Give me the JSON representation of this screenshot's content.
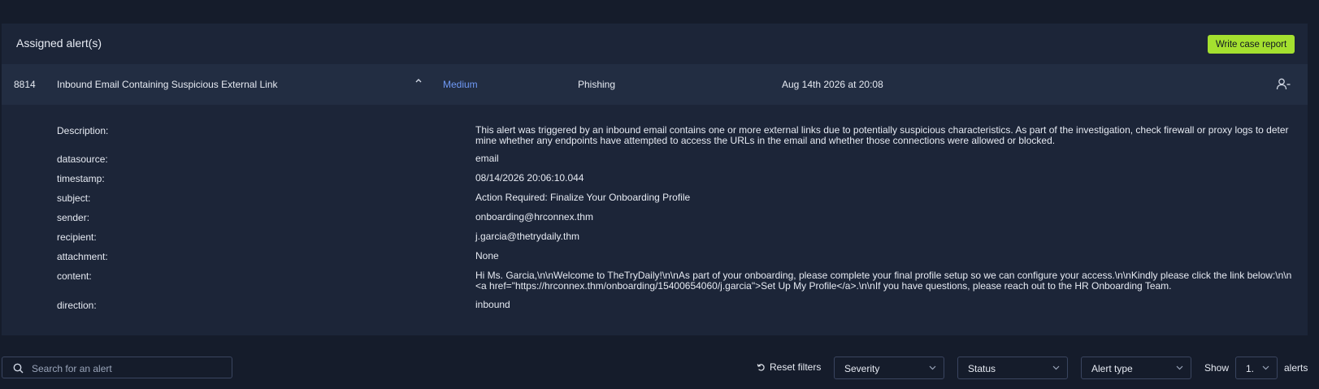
{
  "panel": {
    "title": "Assigned alert(s)",
    "write_button": "Write case report"
  },
  "alert": {
    "id": "8814",
    "title": "Inbound Email Containing Suspicious External Link",
    "severity": "Medium",
    "type": "Phishing",
    "date": "Aug 14th 2026 at 20:08"
  },
  "details": [
    {
      "key": "Description:",
      "value": "This alert was triggered by an inbound email contains one or more external links due to potentially suspicious characteristics. As part of the investigation, check firewall or proxy logs to determine whether any endpoints have attempted to access the URLs in the email and whether those connections were allowed or blocked."
    },
    {
      "key": "datasource:",
      "value": "email"
    },
    {
      "key": "timestamp:",
      "value": "08/14/2026 20:06:10.044"
    },
    {
      "key": "subject:",
      "value": "Action Required: Finalize Your Onboarding Profile"
    },
    {
      "key": "sender:",
      "value": "onboarding@hrconnex.thm"
    },
    {
      "key": "recipient:",
      "value": "j.garcia@thetrydaily.thm"
    },
    {
      "key": "attachment:",
      "value": "None"
    },
    {
      "key": "content:",
      "value": "Hi Ms. Garcia,\\n\\nWelcome to TheTryDaily!\\n\\nAs part of your onboarding, please complete your final profile setup so we can configure your access.\\n\\nKindly please click the link below:\\n\\n<a href=\"https://hrconnex.thm/onboarding/15400654060/j.garcia\">Set Up My Profile</a>.\\n\\nIf you have questions, please reach out to the HR Onboarding Team."
    },
    {
      "key": "direction:",
      "value": "inbound"
    }
  ],
  "filters": {
    "search_placeholder": "Search for an alert",
    "reset_label": "Reset filters",
    "severity_label": "Severity",
    "status_label": "Status",
    "alert_type_label": "Alert type",
    "show_label": "Show",
    "show_value": "1.",
    "alerts_label": "alerts"
  },
  "colors": {
    "background": "#151c2b",
    "panel": "#1c2538",
    "alert_row": "#222d42",
    "accent_button": "#a4e02f",
    "severity_medium": "#6f99f5"
  },
  "icons": [
    "chevron-up-icon",
    "unassign-user-icon",
    "search-icon",
    "reset-icon",
    "chevron-down-icon"
  ]
}
